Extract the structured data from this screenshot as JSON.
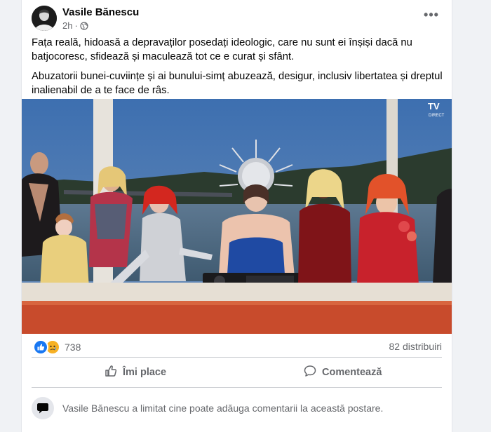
{
  "post": {
    "author": "Vasile Bănescu",
    "time": "2h",
    "paragraphs": [
      "Fața reală, hidoasă a depravaților posedați ideologic, care nu sunt ei înșiși dacă nu batjocoresc, sfidează și maculează tot ce e curat și sfânt.",
      "Abuzatorii bunei-cuviințe și ai bunului-simț abuzează, desigur, inclusiv libertatea și dreptul inalienabil de a te face de râs."
    ],
    "image_watermark": "TV",
    "image_watermark_sub": "DIRECT",
    "reaction_count": "738",
    "shares": "82 distribuiri",
    "like_label": "Îmi place",
    "comment_label": "Comentează",
    "notice": "Vasile Bănescu a limitat cine poate adăuga comentarii la această postare."
  },
  "colors": {
    "like_blue": "#1877f2",
    "sad_yellow": "#f7b125",
    "muted_text": "#65676b"
  },
  "icons": [
    "globe-icon",
    "more-icon",
    "like-reaction-icon",
    "sad-reaction-icon",
    "thumbs-up-icon",
    "comment-icon",
    "speech-bubble-icon"
  ]
}
